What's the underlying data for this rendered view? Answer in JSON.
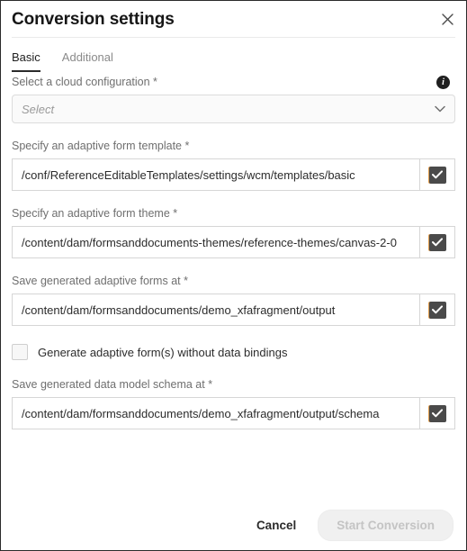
{
  "dialog": {
    "title": "Conversion settings",
    "close_icon": "close-icon"
  },
  "tabs": [
    {
      "label": "Basic",
      "active": true
    },
    {
      "label": "Additional",
      "active": false
    }
  ],
  "fields": {
    "cloud_config": {
      "label": "Select a cloud configuration *",
      "placeholder": "Select",
      "value": "",
      "info_icon": "i"
    },
    "form_template": {
      "label": "Specify an adaptive form template *",
      "value": "/conf/ReferenceEditableTemplates/settings/wcm/templates/basic",
      "checked": true
    },
    "form_theme": {
      "label": "Specify an adaptive form theme *",
      "value": "/content/dam/formsanddocuments-themes/reference-themes/canvas-2-0",
      "checked": true
    },
    "forms_output": {
      "label": "Save generated adaptive forms at *",
      "value": "/content/dam/formsanddocuments/demo_xfafragment/output",
      "checked": true
    },
    "no_data_bindings": {
      "label": "Generate adaptive form(s) without data bindings",
      "checked": false
    },
    "schema_output": {
      "label": "Save generated data model schema at *",
      "value": "/content/dam/formsanddocuments/demo_xfafragment/output/schema",
      "checked": true
    }
  },
  "footer": {
    "cancel_label": "Cancel",
    "start_label": "Start Conversion",
    "start_disabled": true
  },
  "colors": {
    "title": "#161616",
    "label": "#6f6f6f",
    "value": "#2c2c2c",
    "accent_focus": "#e09b4a",
    "checkbox_fill": "#4a4a4a",
    "tab_active_underline": "#2b2b2b",
    "cta_disabled_bg": "#f0f0f0",
    "cta_disabled_text": "#c4c4c4"
  }
}
